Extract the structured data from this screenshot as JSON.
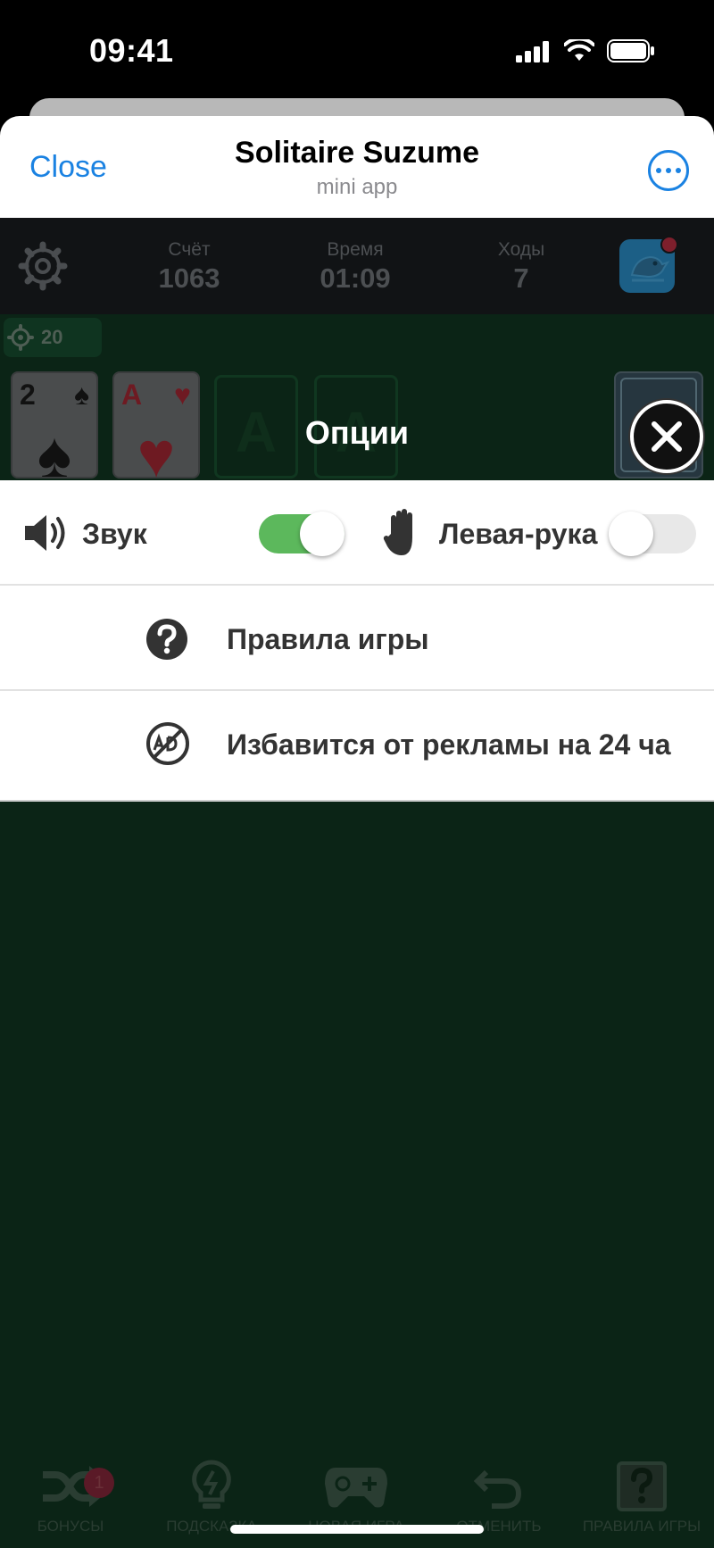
{
  "status_bar": {
    "time": "09:41"
  },
  "mini_app": {
    "close_label": "Close",
    "title": "Solitaire Suzume",
    "subtitle": "mini app"
  },
  "game": {
    "stats": [
      {
        "label": "Счёт",
        "value": "1063"
      },
      {
        "label": "Время",
        "value": "01:09"
      },
      {
        "label": "Ходы",
        "value": "7"
      }
    ],
    "hint_count": "20",
    "cards": [
      {
        "rank": "2",
        "suit": "♠"
      },
      {
        "rank": "A",
        "suit": "♥"
      }
    ],
    "foundation_letter": "A"
  },
  "options": {
    "title": "Опции",
    "sound_label": "Звук",
    "sound_on": true,
    "left_hand_label": "Левая-рука",
    "left_hand_on": false,
    "rules_label": "Правила игры",
    "remove_ads_label": "Избавится от рекламы на 24 ча"
  },
  "toolbar": {
    "bonus_badge": "1",
    "items": [
      "БОНУСЫ",
      "ПОДСКАЗКА",
      "НОВАЯ ИГРА",
      "ОТМЕНИТЬ",
      "ПРАВИЛА ИГРЫ"
    ]
  },
  "colors": {
    "link_blue": "#1a82e2",
    "toggle_on": "#5cb85c",
    "toggle_off": "#e8e8e8",
    "game_bg": "#0b2416"
  }
}
